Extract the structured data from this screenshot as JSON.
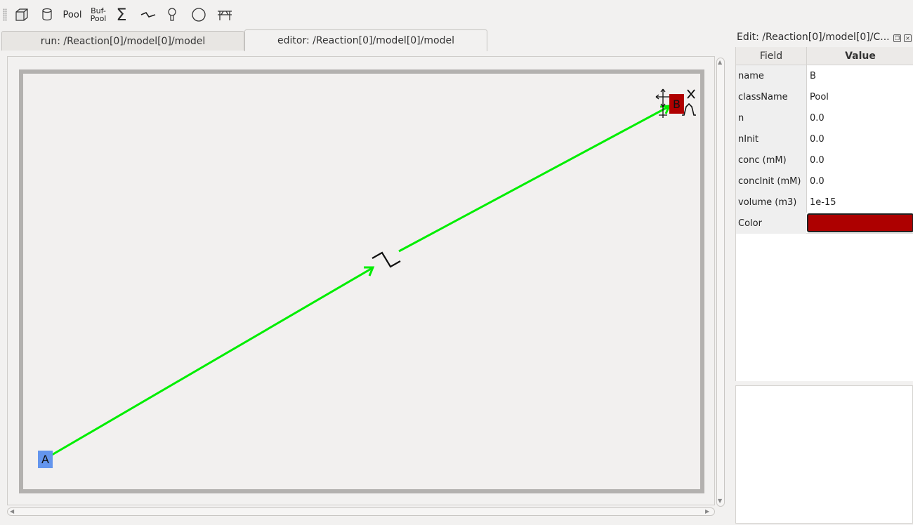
{
  "toolbar": {
    "items": [
      {
        "name": "compartment-icon"
      },
      {
        "name": "cylinder-icon"
      },
      {
        "label": "Pool"
      },
      {
        "label_line1": "Buf-",
        "label_line2": "Pool"
      },
      {
        "symbol": "Σ"
      },
      {
        "name": "reaction-icon"
      },
      {
        "name": "enzyme-icon"
      },
      {
        "name": "circle-icon"
      },
      {
        "name": "stimulus-table-icon"
      }
    ]
  },
  "tabs": [
    {
      "label": "run: /Reaction[0]/model[0]/model",
      "active": false
    },
    {
      "label": "editor: /Reaction[0]/model[0]/model",
      "active": true
    }
  ],
  "canvas": {
    "nodes": [
      {
        "label": "A",
        "color": "#6495ed"
      },
      {
        "label": "B",
        "color": "#b00000"
      }
    ],
    "edge_color": "#00ee00"
  },
  "editor": {
    "title": "Edit: /Reaction[0]/model[0]/C...",
    "headers": {
      "field": "Field",
      "value": "Value"
    },
    "rows": [
      {
        "field": "name",
        "value": "B"
      },
      {
        "field": "className",
        "value": "Pool"
      },
      {
        "field": "n",
        "value": "0.0"
      },
      {
        "field": "nInit",
        "value": "0.0"
      },
      {
        "field": "conc (mM)",
        "value": "0.0"
      },
      {
        "field": "concInit (mM)",
        "value": "0.0"
      },
      {
        "field": "volume (m3)",
        "value": "1e-15"
      },
      {
        "field": "Color",
        "value": ""
      }
    ],
    "color_value": "#ad0000"
  }
}
